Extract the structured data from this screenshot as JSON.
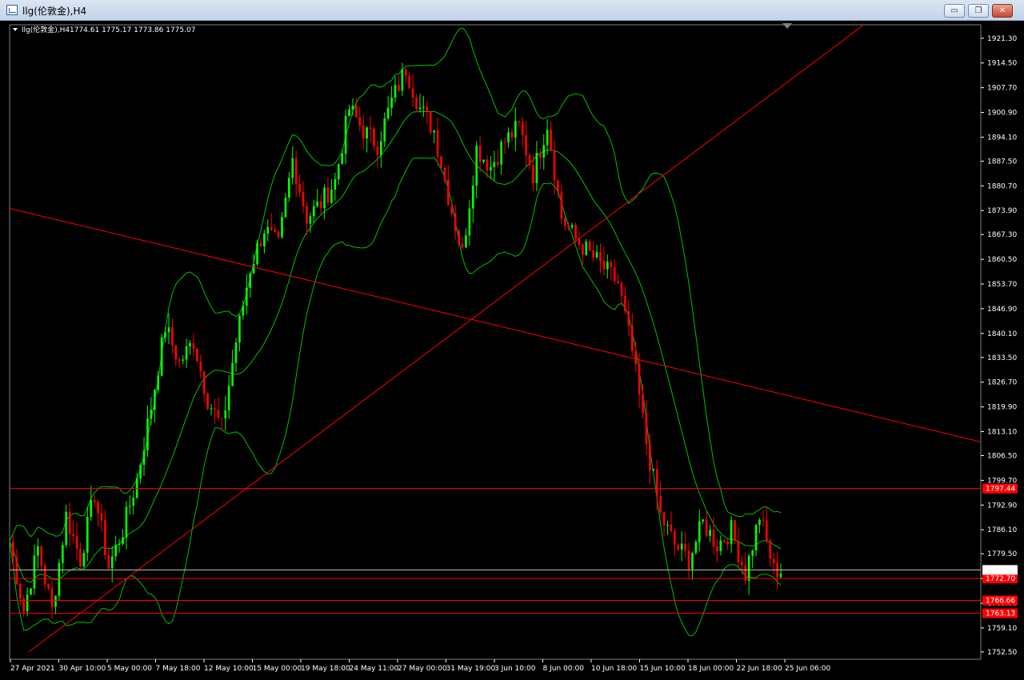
{
  "window": {
    "title": "llg(伦敦金),H4",
    "buttons": {
      "minimize": "▭",
      "restore": "❐",
      "close": "✕"
    }
  },
  "chart_info": {
    "symbol_label": "llg(伦敦金),H4",
    "ohlc": "1774.61 1775.17 1773.86 1775.07"
  },
  "colors": {
    "background": "#000000",
    "bull_candle": "#00ff00",
    "bear_candle": "#ff0000",
    "band": "#00c000",
    "trendline": "#ff0000",
    "level_line": "#ff0000",
    "price_line": "#c0c0c0"
  },
  "chart_data": {
    "type": "candlestick",
    "symbol": "llg(伦敦金)",
    "timeframe": "H4",
    "price_axis": {
      "ticks": [
        "1921.30",
        "1914.50",
        "1907.70",
        "1900.90",
        "1894.10",
        "1887.50",
        "1880.70",
        "1873.90",
        "1867.30",
        "1860.50",
        "1853.70",
        "1846.90",
        "1840.10",
        "1833.50",
        "1826.70",
        "1819.90",
        "1813.10",
        "1806.50",
        "1799.70",
        "1792.90",
        "1786.10",
        "1779.50",
        "1772.70",
        "1765.90",
        "1759.10",
        "1752.50"
      ],
      "ylim": [
        1750.5,
        1925.0
      ]
    },
    "time_axis": {
      "ticks": [
        "27 Apr 2021",
        "30 Apr 10:00",
        "5 May 00:00",
        "7 May 18:00",
        "12 May 10:00",
        "15 May 00:00",
        "19 May 18:00",
        "24 May 11:00",
        "27 May 00:00",
        "31 May 19:00",
        "3 Jun 10:00",
        "8 Jun 00:00",
        "10 Jun 18:00",
        "15 Jun 10:00",
        "18 Jun 00:00",
        "22 Jun 18:00",
        "25 Jun 06:00"
      ]
    },
    "current_price": "1775.07",
    "horizontal_levels": [
      {
        "value": 1797.44,
        "label": "1797.44"
      },
      {
        "value": 1772.7,
        "label": "1772.70"
      },
      {
        "value": 1766.66,
        "label": "1766.66"
      },
      {
        "value": 1763.13,
        "label": "1763.13"
      }
    ],
    "trendlines": [
      {
        "from": [
          "27 Apr 2021",
          1874.5
        ],
        "to": [
          "25 Jun 06:00",
          1823.5
        ],
        "extends_right": true
      },
      {
        "from": [
          "27 Apr 2021",
          1752.5
        ],
        "to": [
          "17 Jun 12:00",
          1892.0
        ],
        "extends_right": true
      }
    ],
    "path_points": [
      [
        0,
        1783
      ],
      [
        4,
        1764
      ],
      [
        8,
        1781
      ],
      [
        12,
        1764
      ],
      [
        16,
        1790
      ],
      [
        20,
        1778
      ],
      [
        24,
        1796
      ],
      [
        28,
        1776
      ],
      [
        32,
        1786
      ],
      [
        36,
        1800
      ],
      [
        40,
        1820
      ],
      [
        44,
        1842
      ],
      [
        48,
        1832
      ],
      [
        52,
        1838
      ],
      [
        56,
        1822
      ],
      [
        60,
        1814
      ],
      [
        64,
        1838
      ],
      [
        68,
        1858
      ],
      [
        72,
        1869
      ],
      [
        76,
        1864
      ],
      [
        80,
        1888
      ],
      [
        84,
        1872
      ],
      [
        88,
        1876
      ],
      [
        92,
        1882
      ],
      [
        96,
        1902
      ],
      [
        100,
        1896
      ],
      [
        104,
        1892
      ],
      [
        108,
        1904
      ],
      [
        112,
        1913
      ],
      [
        116,
        1902
      ],
      [
        120,
        1896
      ],
      [
        124,
        1878
      ],
      [
        128,
        1862
      ],
      [
        132,
        1891
      ],
      [
        136,
        1886
      ],
      [
        140,
        1893
      ],
      [
        144,
        1897
      ],
      [
        148,
        1884
      ],
      [
        152,
        1898
      ],
      [
        156,
        1872
      ],
      [
        160,
        1866
      ],
      [
        164,
        1862
      ],
      [
        168,
        1858
      ],
      [
        172,
        1854
      ],
      [
        176,
        1835
      ],
      [
        180,
        1810
      ],
      [
        184,
        1790
      ],
      [
        188,
        1782
      ],
      [
        192,
        1778
      ],
      [
        196,
        1788
      ],
      [
        200,
        1782
      ],
      [
        204,
        1786
      ],
      [
        208,
        1774
      ],
      [
        212,
        1790
      ],
      [
        216,
        1775
      ],
      [
        218,
        1775
      ]
    ]
  }
}
